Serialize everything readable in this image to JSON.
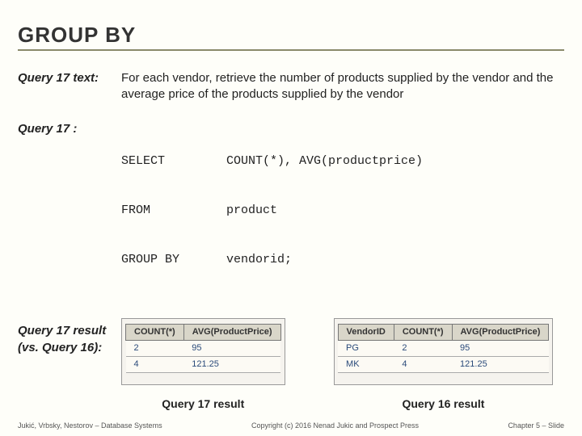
{
  "title": "GROUP BY",
  "q_text_label": "Query 17 text:",
  "q_text": "For each vendor, retrieve the number of products supplied by the vendor and the average price of the products supplied by the vendor",
  "q_label": "Query 17 :",
  "sql": {
    "l1k": "SELECT",
    "l1v": "COUNT(*), AVG(productprice)",
    "l2k": "FROM",
    "l2v": "product",
    "l3k": "GROUP BY",
    "l3v": "vendorid;"
  },
  "result_label": "Query 17 result (vs. Query 16):",
  "t17": {
    "caption": "Query 17 result",
    "headers": [
      "COUNT(*)",
      "AVG(ProductPrice)"
    ],
    "rows": [
      [
        "2",
        "95"
      ],
      [
        "4",
        "121.25"
      ]
    ]
  },
  "t16": {
    "caption": "Query 16 result",
    "headers": [
      "VendorID",
      "COUNT(*)",
      "AVG(ProductPrice)"
    ],
    "rows": [
      [
        "PG",
        "2",
        "95"
      ],
      [
        "MK",
        "4",
        "121.25"
      ]
    ]
  },
  "footer": {
    "left": "Jukić, Vrbsky, Nestorov – Database Systems",
    "center": "Copyright (c) 2016 Nenad Jukic and Prospect Press",
    "right": "Chapter 5 – Slide"
  }
}
